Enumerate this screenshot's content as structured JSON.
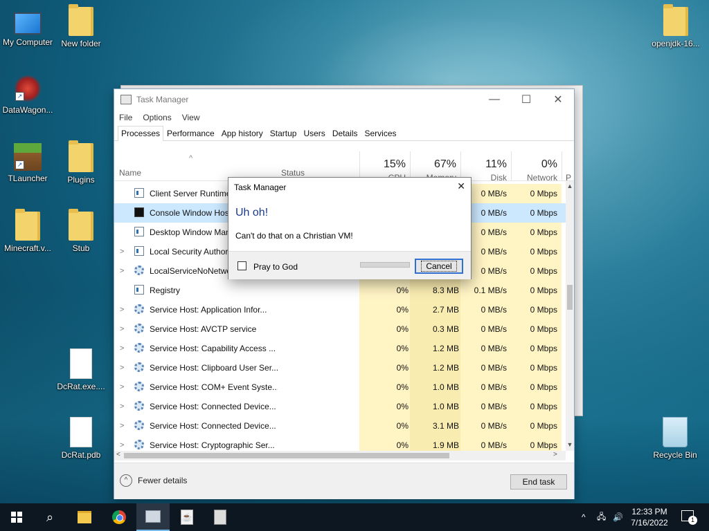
{
  "desktop": {
    "icons": [
      {
        "label": "My Computer"
      },
      {
        "label": "New folder"
      },
      {
        "label": "DataWagon..."
      },
      {
        "label": "TLauncher"
      },
      {
        "label": "Plugins"
      },
      {
        "label": "Minecraft.v..."
      },
      {
        "label": "Stub"
      },
      {
        "label": "DcRat.exe...."
      },
      {
        "label": "DcRat.pdb"
      },
      {
        "label": "openjdk-16..."
      },
      {
        "label": "Recycle Bin"
      }
    ]
  },
  "taskmanager": {
    "title": "Task Manager",
    "menu": [
      "File",
      "Options",
      "View"
    ],
    "tabs": [
      "Processes",
      "Performance",
      "App history",
      "Startup",
      "Users",
      "Details",
      "Services"
    ],
    "columns": {
      "name": "Name",
      "status": "Status",
      "cpu": {
        "pct": "15%",
        "label": "CPU"
      },
      "memory": {
        "pct": "67%",
        "label": "Memory"
      },
      "disk": {
        "pct": "11%",
        "label": "Disk"
      },
      "network": {
        "pct": "0%",
        "label": "Network"
      },
      "power": "P"
    },
    "rows": [
      {
        "name": "Client Server Runtime Process",
        "cpu": "",
        "memory": "",
        "disk": "0 MB/s",
        "network": "0 Mbps"
      },
      {
        "name": "Console Window Host",
        "cpu": "",
        "memory": "",
        "disk": "0 MB/s",
        "network": "0 Mbps"
      },
      {
        "name": "Desktop Window Manager",
        "cpu": "",
        "memory": "",
        "disk": "0 MB/s",
        "network": "0 Mbps"
      },
      {
        "name": "Local Security Authority Process",
        "cpu": "",
        "memory": "",
        "disk": "0 MB/s",
        "network": "0 Mbps"
      },
      {
        "name": "LocalServiceNoNetwork",
        "cpu": "",
        "memory": "",
        "disk": "0 MB/s",
        "network": "0 Mbps"
      },
      {
        "name": "Registry",
        "cpu": "0%",
        "memory": "8.3 MB",
        "disk": "0.1 MB/s",
        "network": "0 Mbps"
      },
      {
        "name": "Service Host: Application Infor...",
        "cpu": "0%",
        "memory": "2.7 MB",
        "disk": "0 MB/s",
        "network": "0 Mbps"
      },
      {
        "name": "Service Host: AVCTP service",
        "cpu": "0%",
        "memory": "0.3 MB",
        "disk": "0 MB/s",
        "network": "0 Mbps"
      },
      {
        "name": "Service Host: Capability Access ...",
        "cpu": "0%",
        "memory": "1.2 MB",
        "disk": "0 MB/s",
        "network": "0 Mbps"
      },
      {
        "name": "Service Host: Clipboard User Ser...",
        "cpu": "0%",
        "memory": "1.2 MB",
        "disk": "0 MB/s",
        "network": "0 Mbps"
      },
      {
        "name": "Service Host: COM+ Event Syste...",
        "cpu": "0%",
        "memory": "1.0 MB",
        "disk": "0 MB/s",
        "network": "0 Mbps"
      },
      {
        "name": "Service Host: Connected Device...",
        "cpu": "0%",
        "memory": "1.0 MB",
        "disk": "0 MB/s",
        "network": "0 Mbps"
      },
      {
        "name": "Service Host: Connected Device...",
        "cpu": "0%",
        "memory": "3.1 MB",
        "disk": "0 MB/s",
        "network": "0 Mbps"
      },
      {
        "name": "Service Host: Cryptographic Ser...",
        "cpu": "0%",
        "memory": "1.9 MB",
        "disk": "0 MB/s",
        "network": "0 Mbps"
      }
    ],
    "footer": {
      "fewer_details": "Fewer details",
      "end_task": "End task"
    }
  },
  "dialog": {
    "title": "Task Manager",
    "heading": "Uh oh!",
    "message": "Can't do that on a Christian VM!",
    "checkbox_label": "Pray to God",
    "cancel_label": "Cancel"
  },
  "taskbar": {
    "time": "12:33 PM",
    "date": "7/16/2022",
    "notification_count": "1"
  }
}
